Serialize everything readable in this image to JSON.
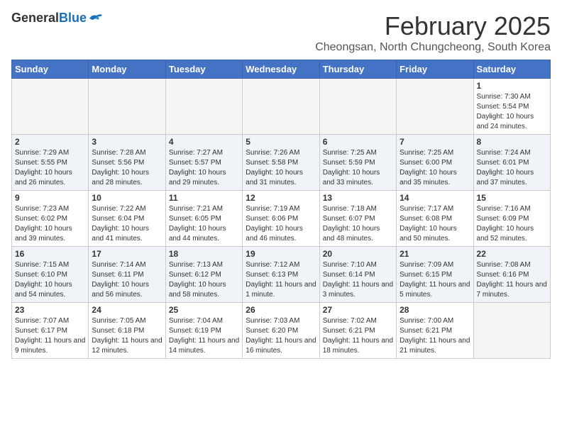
{
  "logo": {
    "general": "General",
    "blue": "Blue"
  },
  "title": {
    "month_year": "February 2025",
    "location": "Cheongsan, North Chungcheong, South Korea"
  },
  "weekdays": [
    "Sunday",
    "Monday",
    "Tuesday",
    "Wednesday",
    "Thursday",
    "Friday",
    "Saturday"
  ],
  "weeks": [
    [
      {
        "day": "",
        "empty": true
      },
      {
        "day": "",
        "empty": true
      },
      {
        "day": "",
        "empty": true
      },
      {
        "day": "",
        "empty": true
      },
      {
        "day": "",
        "empty": true
      },
      {
        "day": "",
        "empty": true
      },
      {
        "day": "1",
        "sunrise": "Sunrise: 7:30 AM",
        "sunset": "Sunset: 5:54 PM",
        "daylight": "Daylight: 10 hours and 24 minutes."
      }
    ],
    [
      {
        "day": "2",
        "sunrise": "Sunrise: 7:29 AM",
        "sunset": "Sunset: 5:55 PM",
        "daylight": "Daylight: 10 hours and 26 minutes."
      },
      {
        "day": "3",
        "sunrise": "Sunrise: 7:28 AM",
        "sunset": "Sunset: 5:56 PM",
        "daylight": "Daylight: 10 hours and 28 minutes."
      },
      {
        "day": "4",
        "sunrise": "Sunrise: 7:27 AM",
        "sunset": "Sunset: 5:57 PM",
        "daylight": "Daylight: 10 hours and 29 minutes."
      },
      {
        "day": "5",
        "sunrise": "Sunrise: 7:26 AM",
        "sunset": "Sunset: 5:58 PM",
        "daylight": "Daylight: 10 hours and 31 minutes."
      },
      {
        "day": "6",
        "sunrise": "Sunrise: 7:25 AM",
        "sunset": "Sunset: 5:59 PM",
        "daylight": "Daylight: 10 hours and 33 minutes."
      },
      {
        "day": "7",
        "sunrise": "Sunrise: 7:25 AM",
        "sunset": "Sunset: 6:00 PM",
        "daylight": "Daylight: 10 hours and 35 minutes."
      },
      {
        "day": "8",
        "sunrise": "Sunrise: 7:24 AM",
        "sunset": "Sunset: 6:01 PM",
        "daylight": "Daylight: 10 hours and 37 minutes."
      }
    ],
    [
      {
        "day": "9",
        "sunrise": "Sunrise: 7:23 AM",
        "sunset": "Sunset: 6:02 PM",
        "daylight": "Daylight: 10 hours and 39 minutes."
      },
      {
        "day": "10",
        "sunrise": "Sunrise: 7:22 AM",
        "sunset": "Sunset: 6:04 PM",
        "daylight": "Daylight: 10 hours and 41 minutes."
      },
      {
        "day": "11",
        "sunrise": "Sunrise: 7:21 AM",
        "sunset": "Sunset: 6:05 PM",
        "daylight": "Daylight: 10 hours and 44 minutes."
      },
      {
        "day": "12",
        "sunrise": "Sunrise: 7:19 AM",
        "sunset": "Sunset: 6:06 PM",
        "daylight": "Daylight: 10 hours and 46 minutes."
      },
      {
        "day": "13",
        "sunrise": "Sunrise: 7:18 AM",
        "sunset": "Sunset: 6:07 PM",
        "daylight": "Daylight: 10 hours and 48 minutes."
      },
      {
        "day": "14",
        "sunrise": "Sunrise: 7:17 AM",
        "sunset": "Sunset: 6:08 PM",
        "daylight": "Daylight: 10 hours and 50 minutes."
      },
      {
        "day": "15",
        "sunrise": "Sunrise: 7:16 AM",
        "sunset": "Sunset: 6:09 PM",
        "daylight": "Daylight: 10 hours and 52 minutes."
      }
    ],
    [
      {
        "day": "16",
        "sunrise": "Sunrise: 7:15 AM",
        "sunset": "Sunset: 6:10 PM",
        "daylight": "Daylight: 10 hours and 54 minutes."
      },
      {
        "day": "17",
        "sunrise": "Sunrise: 7:14 AM",
        "sunset": "Sunset: 6:11 PM",
        "daylight": "Daylight: 10 hours and 56 minutes."
      },
      {
        "day": "18",
        "sunrise": "Sunrise: 7:13 AM",
        "sunset": "Sunset: 6:12 PM",
        "daylight": "Daylight: 10 hours and 58 minutes."
      },
      {
        "day": "19",
        "sunrise": "Sunrise: 7:12 AM",
        "sunset": "Sunset: 6:13 PM",
        "daylight": "Daylight: 11 hours and 1 minute."
      },
      {
        "day": "20",
        "sunrise": "Sunrise: 7:10 AM",
        "sunset": "Sunset: 6:14 PM",
        "daylight": "Daylight: 11 hours and 3 minutes."
      },
      {
        "day": "21",
        "sunrise": "Sunrise: 7:09 AM",
        "sunset": "Sunset: 6:15 PM",
        "daylight": "Daylight: 11 hours and 5 minutes."
      },
      {
        "day": "22",
        "sunrise": "Sunrise: 7:08 AM",
        "sunset": "Sunset: 6:16 PM",
        "daylight": "Daylight: 11 hours and 7 minutes."
      }
    ],
    [
      {
        "day": "23",
        "sunrise": "Sunrise: 7:07 AM",
        "sunset": "Sunset: 6:17 PM",
        "daylight": "Daylight: 11 hours and 9 minutes."
      },
      {
        "day": "24",
        "sunrise": "Sunrise: 7:05 AM",
        "sunset": "Sunset: 6:18 PM",
        "daylight": "Daylight: 11 hours and 12 minutes."
      },
      {
        "day": "25",
        "sunrise": "Sunrise: 7:04 AM",
        "sunset": "Sunset: 6:19 PM",
        "daylight": "Daylight: 11 hours and 14 minutes."
      },
      {
        "day": "26",
        "sunrise": "Sunrise: 7:03 AM",
        "sunset": "Sunset: 6:20 PM",
        "daylight": "Daylight: 11 hours and 16 minutes."
      },
      {
        "day": "27",
        "sunrise": "Sunrise: 7:02 AM",
        "sunset": "Sunset: 6:21 PM",
        "daylight": "Daylight: 11 hours and 18 minutes."
      },
      {
        "day": "28",
        "sunrise": "Sunrise: 7:00 AM",
        "sunset": "Sunset: 6:21 PM",
        "daylight": "Daylight: 11 hours and 21 minutes."
      },
      {
        "day": "",
        "empty": true
      }
    ]
  ]
}
